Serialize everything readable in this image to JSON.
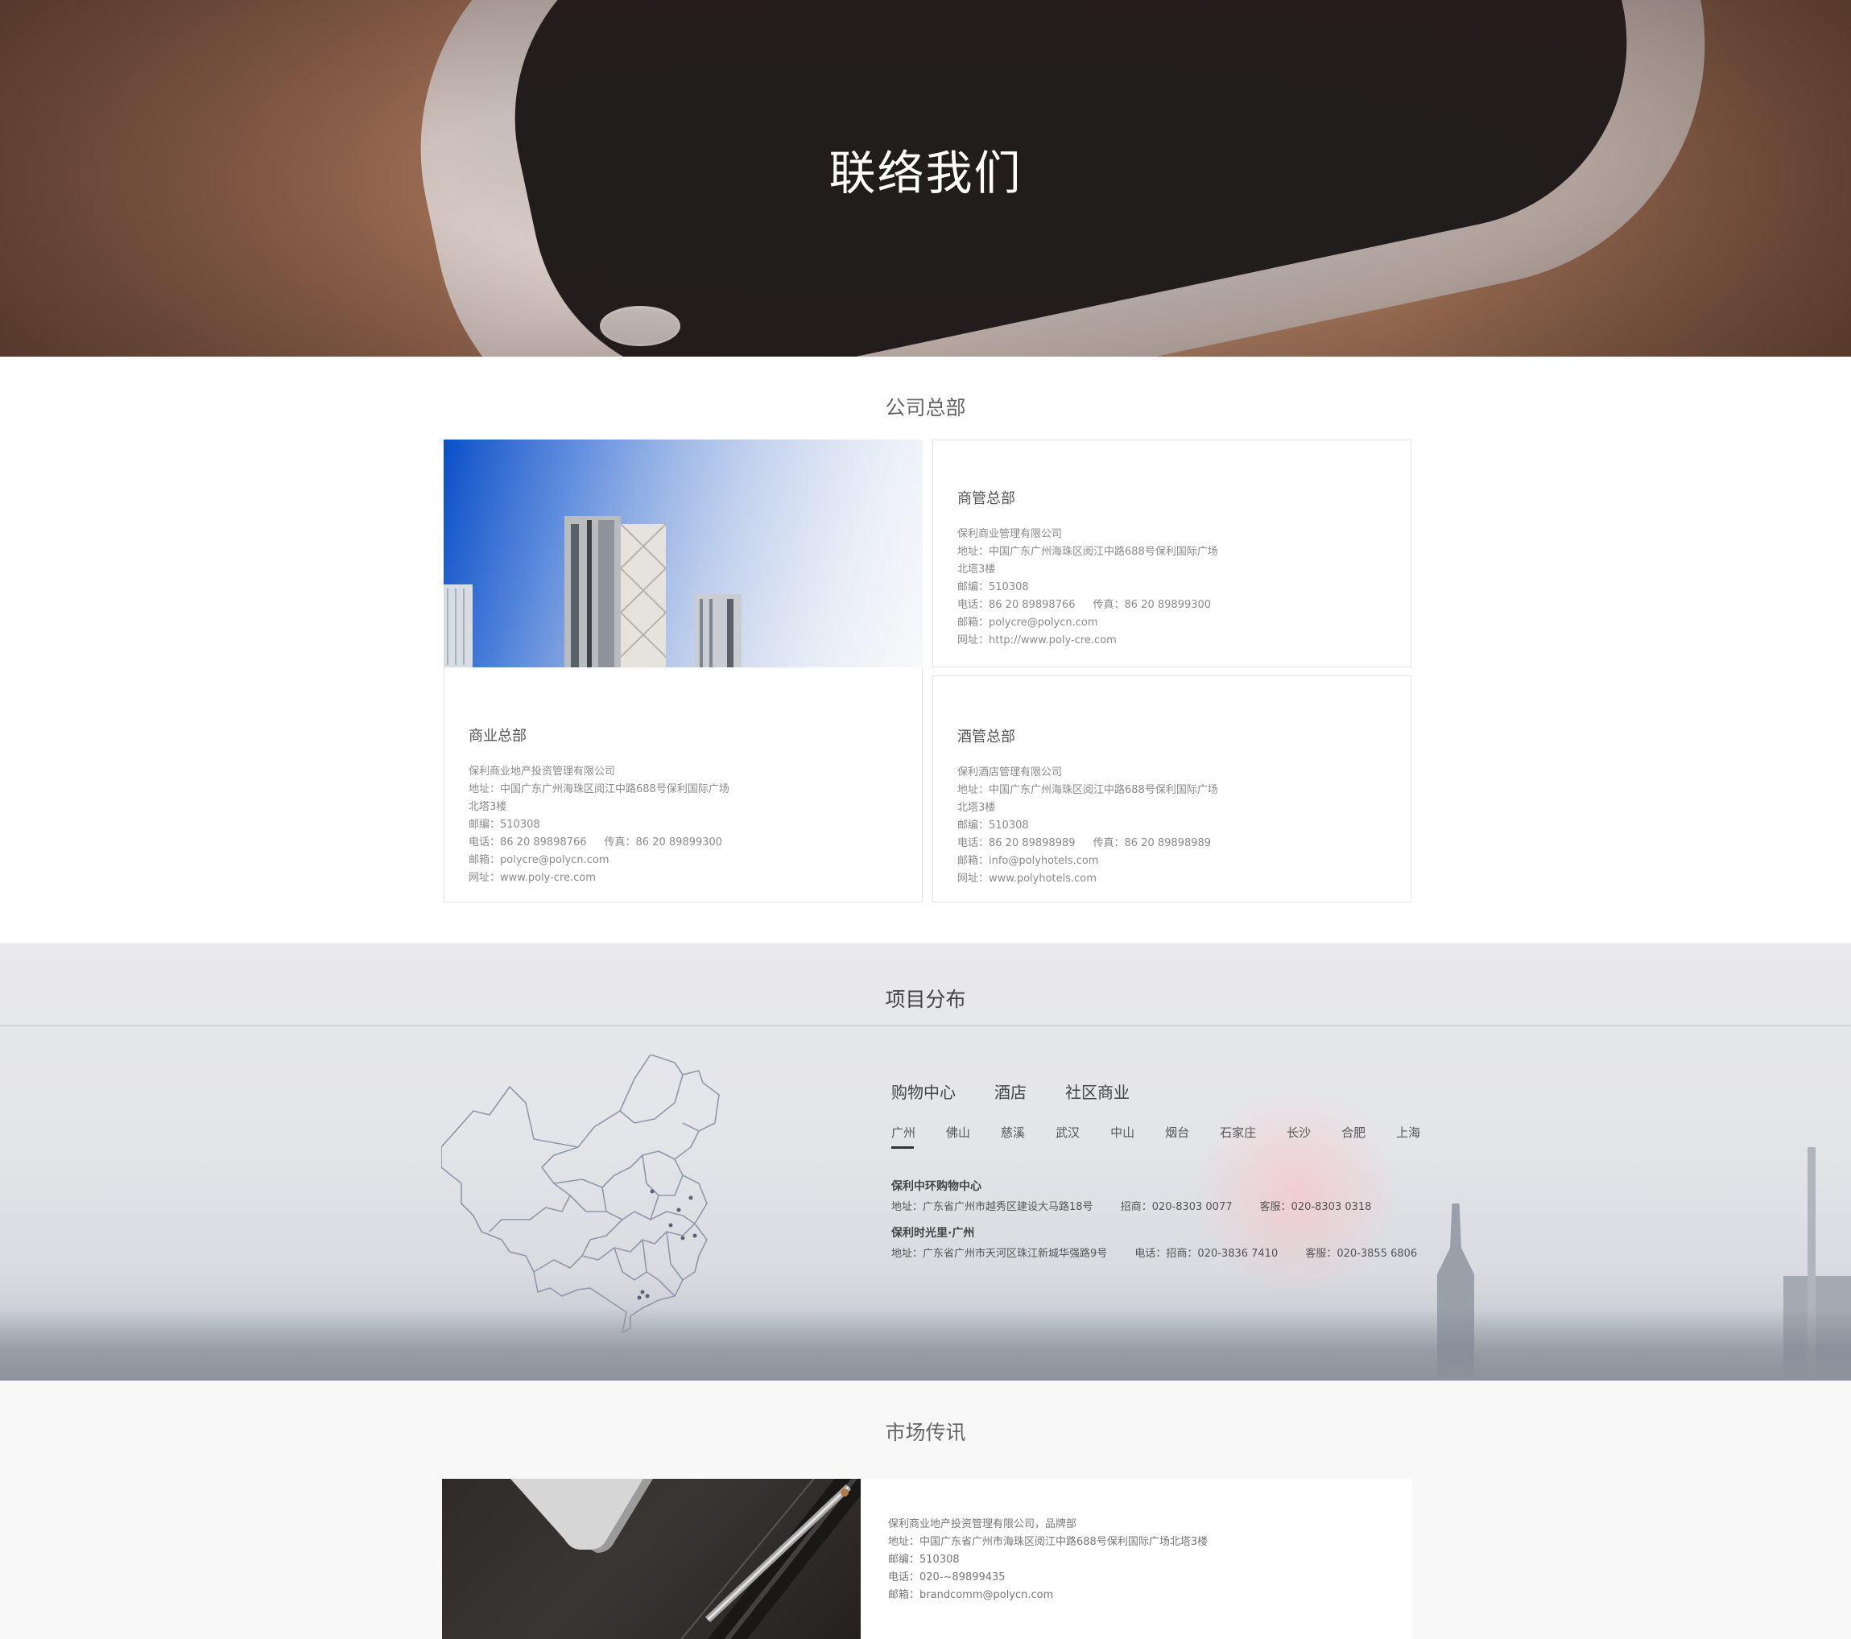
{
  "hero": {
    "title": "联络我们"
  },
  "hq": {
    "title": "公司总部",
    "cards": [
      {
        "heading": "商管总部",
        "company": "保利商业管理有限公司",
        "address": "地址：中国广东广州海珠区阅江中路688号保利国际广场",
        "address2": "北塔3楼",
        "postcode": "邮编：510308",
        "phone": "电话：86 20 89898766",
        "fax": "传真：86 20 89899300",
        "email": "邮箱：polycre@polycn.com",
        "website": "网址：http://www.poly-cre.com"
      },
      {
        "heading": "商业总部",
        "company": "保利商业地产投资管理有限公司",
        "address": "地址：中国广东广州海珠区阅江中路688号保利国际广场",
        "address2": "北塔3楼",
        "postcode": "邮编：510308",
        "phone": "电话：86 20 89898766",
        "fax": "传真：86 20 89899300",
        "email": "邮箱：polycre@polycn.com",
        "website": "网址：www.poly-cre.com"
      },
      {
        "heading": "酒管总部",
        "company": "保利酒店管理有限公司",
        "address": "地址：中国广东广州海珠区阅江中路688号保利国际广场",
        "address2": "北塔3楼",
        "postcode": "邮编：510308",
        "phone": "电话：86 20 89898989",
        "fax": "传真：86 20 89898989",
        "email": "邮箱：info@polyhotels.com",
        "website": "网址：www.polyhotels.com"
      }
    ]
  },
  "projects": {
    "title": "项目分布",
    "categories": [
      "购物中心",
      "酒店",
      "社区商业"
    ],
    "cities": [
      "广州",
      "佛山",
      "慈溪",
      "武汉",
      "中山",
      "烟台",
      "石家庄",
      "长沙",
      "合肥",
      "上海"
    ],
    "active_city": "广州",
    "items": [
      {
        "name": "保利中环购物中心",
        "address": "地址：广东省广州市越秀区建设大马路18号",
        "invest": "招商：020-8303 0077",
        "service": "客服：020-8303 0318"
      },
      {
        "name": "保利时光里·广州",
        "address": "地址：广东省广州市天河区珠江新城华强路9号",
        "invest": "电话：招商：020-3836 7410",
        "service": "客服：020-3855 6806"
      }
    ]
  },
  "news": {
    "title": "市场传讯",
    "company": "保利商业地产投资管理有限公司，品牌部",
    "address": "地址：中国广东省广州市海珠区阅江中路688号保利国际广场北塔3楼",
    "postcode": "邮编：510308",
    "phone": "电话：020-~89899435",
    "email": "邮箱：brandcomm@polycn.com"
  }
}
